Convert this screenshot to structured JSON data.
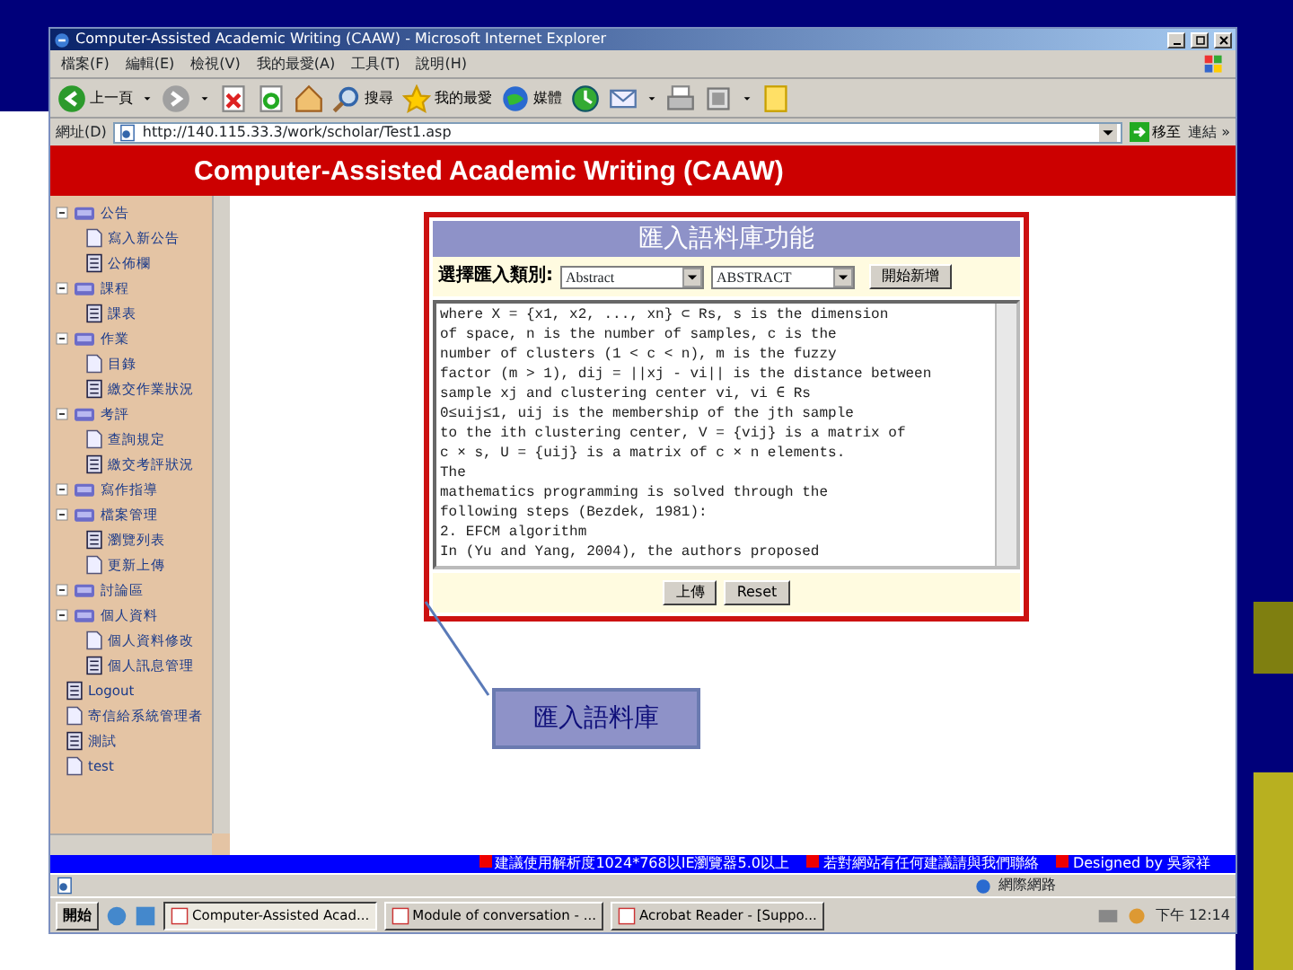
{
  "window": {
    "title": "Computer-Assisted Academic Writing (CAAW) - Microsoft Internet Explorer",
    "menu": [
      "檔案(F)",
      "編輯(E)",
      "檢視(V)",
      "我的最愛(A)",
      "工具(T)",
      "說明(H)"
    ],
    "toolbar": [
      {
        "kind": "back",
        "label": "上一頁"
      },
      {
        "kind": "forward"
      },
      {
        "kind": "stop"
      },
      {
        "kind": "refresh"
      },
      {
        "kind": "home"
      },
      {
        "kind": "search",
        "label": "搜尋"
      },
      {
        "kind": "favorites",
        "label": "我的最愛"
      },
      {
        "kind": "media",
        "label": "媒體"
      },
      {
        "kind": "history"
      },
      {
        "kind": "mail"
      },
      {
        "kind": "print"
      },
      {
        "kind": "edit"
      },
      {
        "kind": "folder"
      }
    ],
    "address": {
      "label": "網址(D)",
      "url": "http://140.115.33.3/work/scholar/Test1.asp",
      "go": "移至",
      "links": "連結 »"
    }
  },
  "page": {
    "banner": "Computer-Assisted Academic Writing (CAAW)",
    "sidebar": {
      "items": [
        {
          "kind": "folder",
          "label": "公告",
          "children": [
            {
              "kind": "page",
              "label": "寫入新公告"
            },
            {
              "kind": "form",
              "label": "公佈欄"
            }
          ]
        },
        {
          "kind": "folder",
          "label": "課程",
          "children": [
            {
              "kind": "form",
              "label": "課表"
            }
          ]
        },
        {
          "kind": "folder",
          "label": "作業",
          "children": [
            {
              "kind": "page",
              "label": "目錄"
            },
            {
              "kind": "form",
              "label": "繳交作業狀況"
            }
          ]
        },
        {
          "kind": "folder",
          "label": "考評",
          "children": [
            {
              "kind": "page",
              "label": "查詢規定"
            },
            {
              "kind": "form",
              "label": "繳交考評狀況"
            }
          ]
        },
        {
          "kind": "folder",
          "label": "寫作指導"
        },
        {
          "kind": "folder",
          "label": "檔案管理",
          "children": [
            {
              "kind": "form",
              "label": "瀏覽列表"
            },
            {
              "kind": "page",
              "label": "更新上傳"
            }
          ]
        },
        {
          "kind": "folder",
          "label": "討論區"
        },
        {
          "kind": "folder",
          "label": "個人資料",
          "children": [
            {
              "kind": "page",
              "label": "個人資料修改"
            },
            {
              "kind": "form",
              "label": "個人訊息管理"
            }
          ]
        },
        {
          "kind": "form",
          "label": "Logout"
        },
        {
          "kind": "page",
          "label": "寄信給系統管理者"
        },
        {
          "kind": "form",
          "label": "測試"
        },
        {
          "kind": "page",
          "label": "test"
        }
      ]
    },
    "form": {
      "title": "匯入語料庫功能",
      "category_label": "選擇匯入類別:",
      "category": "Abstract",
      "section": "ABSTRACT",
      "open_button": "開始新增",
      "text": "where X = {x1, x2, ..., xn} ⊂ Rs, s is the dimension\nof space, n is the number of samples, c is the\nnumber of clusters (1 < c < n), m is the fuzzy\nfactor (m > 1), dij = ||xj - vi|| is the distance between\nsample xj and clustering center vi, vi ∈ Rs\n0≤uij≤1, uij is the membership of the jth sample\nto the ith clustering center, V = {vij} is a matrix of\nc × s, U = {uij} is a matrix of c × n elements.\nThe\nmathematics programming is solved through the\nfollowing steps (Bezdek, 1981):\n2. EFCM algorithm\nIn (Yu and Yang, 2004), the authors proposed",
      "buttons": [
        "上傳",
        "Reset"
      ]
    },
    "callout": "匯入語料庫",
    "marquee": [
      "建議使用解析度1024*768以IE瀏覽器5.0以上",
      "若對網站有任何建議請與我們聯絡",
      "Designed by 吳家祥"
    ]
  },
  "status_bar": {
    "zone": "網際網路"
  },
  "taskbar": {
    "start": "開始",
    "tasks": [
      {
        "label": "Computer-Assisted Acad...",
        "selected": true
      },
      {
        "label": "Module of conversation - ...",
        "selected": false
      },
      {
        "label": "Acrobat Reader - [Suppo...",
        "selected": false
      }
    ],
    "clock": "下午 12:14"
  }
}
